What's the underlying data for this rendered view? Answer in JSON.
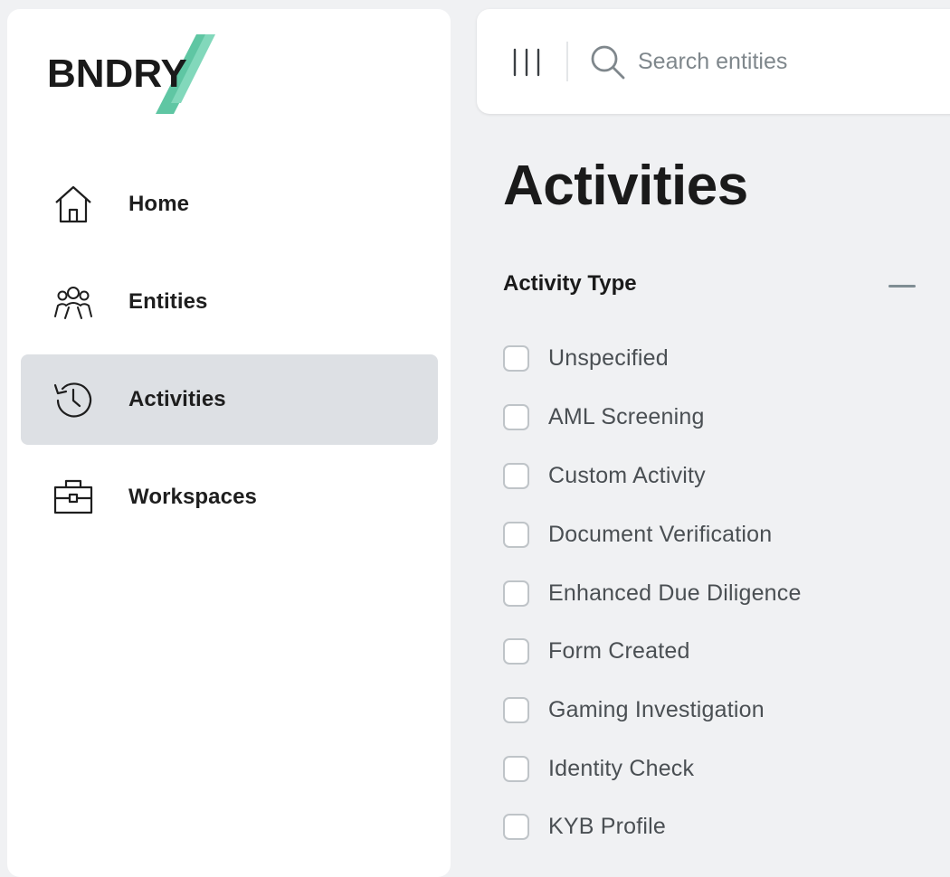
{
  "brand": {
    "name": "BNDRY",
    "accent": "#5fc6a3"
  },
  "sidebar": {
    "items": [
      {
        "label": "Home",
        "icon": "home-icon",
        "active": false
      },
      {
        "label": "Entities",
        "icon": "people-icon",
        "active": false
      },
      {
        "label": "Activities",
        "icon": "history-icon",
        "active": true
      },
      {
        "label": "Workspaces",
        "icon": "briefcase-icon",
        "active": false
      }
    ]
  },
  "topbar": {
    "columns_icon": "columns-icon",
    "search_icon": "search-icon",
    "search_placeholder": "Search entities",
    "search_value": ""
  },
  "page": {
    "title": "Activities"
  },
  "filter": {
    "title": "Activity Type",
    "options": [
      {
        "label": "Unspecified",
        "checked": false
      },
      {
        "label": "AML Screening",
        "checked": false
      },
      {
        "label": "Custom Activity",
        "checked": false
      },
      {
        "label": "Document Verification",
        "checked": false
      },
      {
        "label": "Enhanced Due Diligence",
        "checked": false
      },
      {
        "label": "Form Created",
        "checked": false
      },
      {
        "label": "Gaming Investigation",
        "checked": false
      },
      {
        "label": "Identity Check",
        "checked": false
      },
      {
        "label": "KYB Profile",
        "checked": false
      }
    ]
  },
  "colors": {
    "background": "#f0f1f3",
    "panel": "#ffffff",
    "active_item": "#dde0e4",
    "checkbox_border": "#bfc4c8",
    "muted_text": "#7f878c"
  }
}
